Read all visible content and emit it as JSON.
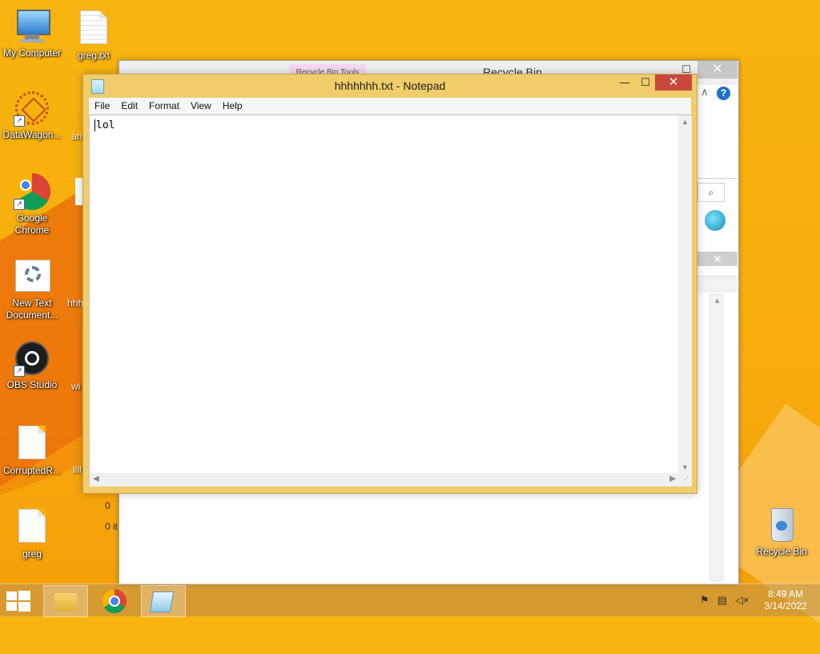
{
  "desktop": {
    "icons": [
      {
        "label": "My Computer",
        "icon": "computer-icon"
      },
      {
        "label": "greg.txt",
        "icon": "text-file-icon"
      },
      {
        "label": "DataWagon...",
        "icon": "datawagon-icon"
      },
      {
        "label": "Google Chrome",
        "icon": "chrome-icon"
      },
      {
        "label": "New Text Document...",
        "icon": "settings-document-icon"
      },
      {
        "label": "OBS Studio",
        "icon": "obs-icon"
      },
      {
        "label": "CorruptedR...",
        "icon": "file-icon"
      },
      {
        "label": "greg",
        "icon": "file-icon"
      },
      {
        "label": "Recycle Bin",
        "icon": "recycle-bin-icon"
      }
    ],
    "partial_labels": [
      "an",
      "hhh",
      "wi",
      "llll"
    ]
  },
  "explorer": {
    "title": "Recycle Bin",
    "ribbon_tab": "Recycle Bin Tools",
    "close_glyph": "✕",
    "help_glyph": "?",
    "status_items": "0 it",
    "status_count": "0"
  },
  "notepad": {
    "title": "hhhhhhh.txt - Notepad",
    "menu": [
      "File",
      "Edit",
      "Format",
      "View",
      "Help"
    ],
    "content": "lol",
    "close_glyph": "✕",
    "minimize_glyph": "—",
    "maximize_glyph": "☐"
  },
  "taskbar": {
    "time": "8:49 AM",
    "date": "3/14/2022",
    "pinned": [
      "file-explorer",
      "google-chrome",
      "notepad"
    ]
  },
  "colors": {
    "desktop": "#f7b40e",
    "notepad_frame": "#f0cc6a",
    "close_button": "#c7473d"
  }
}
